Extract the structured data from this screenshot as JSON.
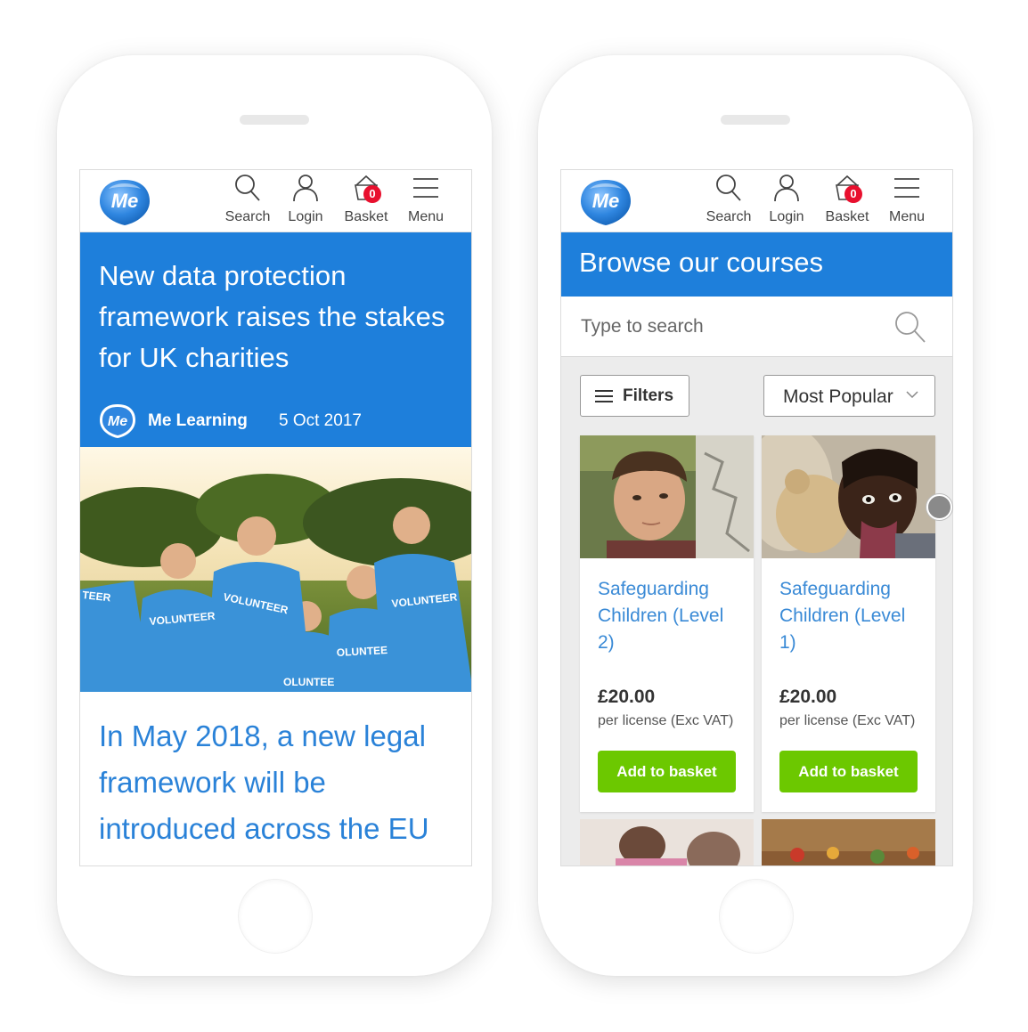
{
  "nav": {
    "search_label": "Search",
    "login_label": "Login",
    "basket_label": "Basket",
    "basket_count": "0",
    "menu_label": "Menu"
  },
  "article": {
    "title": "New data protection framework raises the stakes for UK charities",
    "author": "Me Learning",
    "date": "5 Oct 2017",
    "intro": "In May 2018, a new legal framework will be introduced across the EU"
  },
  "browse": {
    "title": "Browse our courses",
    "search_placeholder": "Type to search",
    "filters_label": "Filters",
    "sort_value": "Most Popular",
    "courses": [
      {
        "title": "Safeguarding Children (Level 2)",
        "price": "£20.00",
        "price_note": "per license (Exc VAT)",
        "button": "Add to basket"
      },
      {
        "title": "Safeguarding Children (Level 1)",
        "price": "£20.00",
        "price_note": "per license (Exc VAT)",
        "button": "Add to basket"
      }
    ]
  },
  "colors": {
    "brand_blue": "#1e7fdb",
    "link_blue": "#3a8ad6",
    "basket_badge": "#e8102e",
    "cta_green": "#6cc800"
  }
}
